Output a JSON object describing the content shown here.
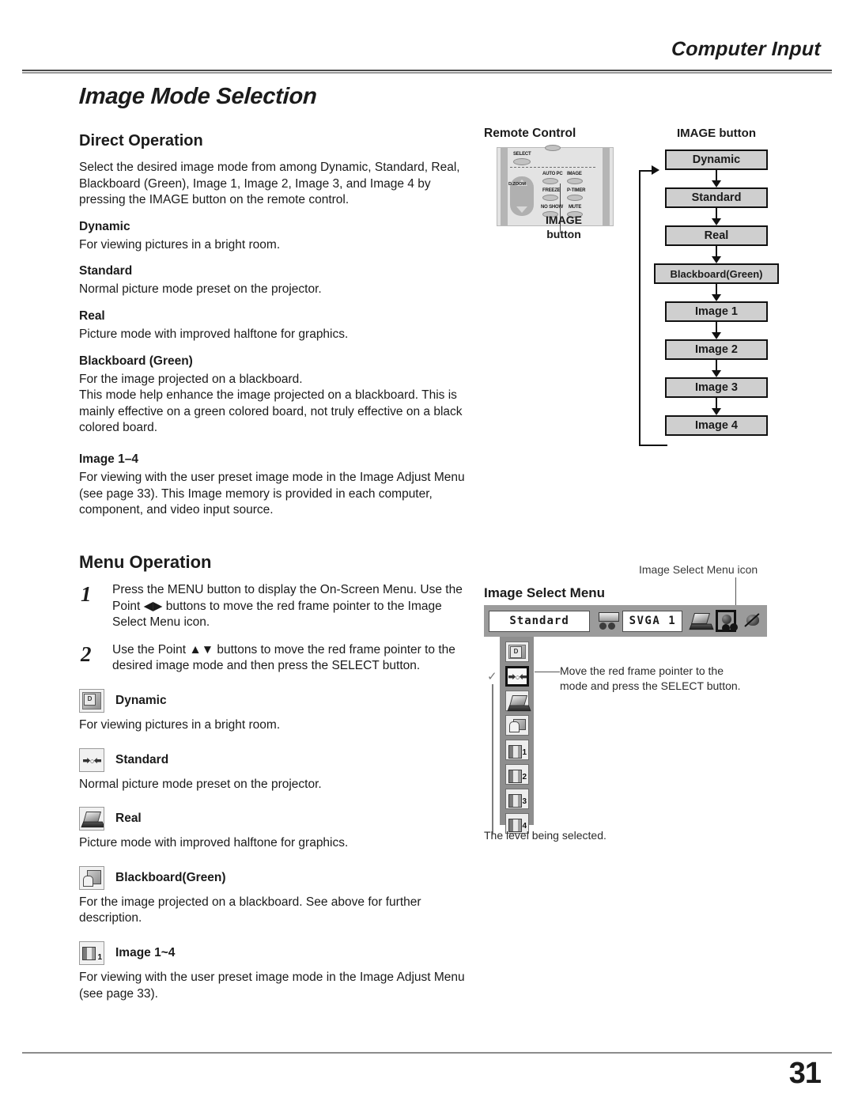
{
  "header": {
    "title": "Computer Input"
  },
  "footer": {
    "page_number": "31"
  },
  "doc": {
    "title": "Image Mode Selection"
  },
  "direct_operation": {
    "heading": "Direct Operation",
    "intro": "Select the desired image mode from among Dynamic, Standard, Real, Blackboard (Green), Image 1, Image 2, Image 3, and Image 4 by pressing the IMAGE button on the remote control.",
    "modes": [
      {
        "term": "Dynamic",
        "desc": "For viewing pictures in a bright room."
      },
      {
        "term": "Standard",
        "desc": "Normal picture mode preset on the projector."
      },
      {
        "term": "Real",
        "desc": "Picture mode with improved halftone for graphics."
      },
      {
        "term": "Blackboard (Green)",
        "desc": "For the image projected on a blackboard.\nThis mode help enhance the image projected on a blackboard. This is mainly effective on a green colored board, not truly effective on a black colored board."
      },
      {
        "term": "Image 1–4",
        "desc": "For viewing with the user preset image mode in the Image Adjust Menu (see page 33). This Image memory is provided in each computer, component, and video input source."
      }
    ]
  },
  "menu_operation": {
    "heading": "Menu Operation",
    "steps": [
      {
        "num": "1",
        "text": "Press the MENU button to display the On-Screen Menu. Use the Point ◀▶ buttons to move the red frame pointer to the Image Select Menu icon."
      },
      {
        "num": "2",
        "text": "Use the Point ▲▼ buttons to move the red frame pointer to the desired image mode and then press the SELECT button."
      }
    ],
    "modes": [
      {
        "icon": "dynamic-icon",
        "label": "Dynamic",
        "desc": "For viewing pictures in a bright room."
      },
      {
        "icon": "standard-icon",
        "label": "Standard",
        "desc": "Normal picture mode preset on the projector."
      },
      {
        "icon": "real-icon",
        "label": "Real",
        "desc": "Picture mode with improved halftone for graphics."
      },
      {
        "icon": "blackboard-icon",
        "label": "Blackboard(Green)",
        "desc": "For the image projected on a blackboard. See above for further description."
      },
      {
        "icon": "image1-icon",
        "label": "Image 1~4",
        "desc": "For viewing with the user preset image mode in the Image Adjust Menu (see page 33)."
      }
    ]
  },
  "remote": {
    "label": "Remote Control",
    "keys": [
      "SELECT",
      "AUTO PC",
      "IMAGE",
      "FREEZE",
      "P-TIMER",
      "NO SHOW",
      "MUTE",
      "D.ZOOM"
    ],
    "callout": "IMAGE\nbutton",
    "callout_line1": "IMAGE",
    "callout_line2": "button"
  },
  "flow": {
    "title": "IMAGE button",
    "boxes": [
      "Dynamic",
      "Standard",
      "Real",
      "Blackboard(Green)",
      "Image 1",
      "Image 2",
      "Image 3",
      "Image 4"
    ]
  },
  "image_select_menu": {
    "title": "Image Select Menu",
    "icon_note": "Image Select Menu icon",
    "osd": {
      "mode_value": "Standard",
      "resolution_value": "SVGA 1",
      "bar_icons": [
        "system-icon",
        "laptop-icon",
        "image-select-icon",
        "image-adjust-icon"
      ],
      "rail_icons": [
        "dynamic-icon",
        "standard-icon",
        "real-icon",
        "blackboard-icon",
        "image1-icon",
        "image2-icon",
        "image3-icon",
        "image4-icon"
      ],
      "selected_rail_index": 1
    },
    "note": "Move the red frame pointer to the mode and press the SELECT button.",
    "level_caption": "The level being selected."
  },
  "colors": {
    "rule": "#8c8c8c",
    "flow_box_fill": "#cfcfcf",
    "osd_bar": "#9b9b9b",
    "osd_rail": "#8e8e8e"
  }
}
